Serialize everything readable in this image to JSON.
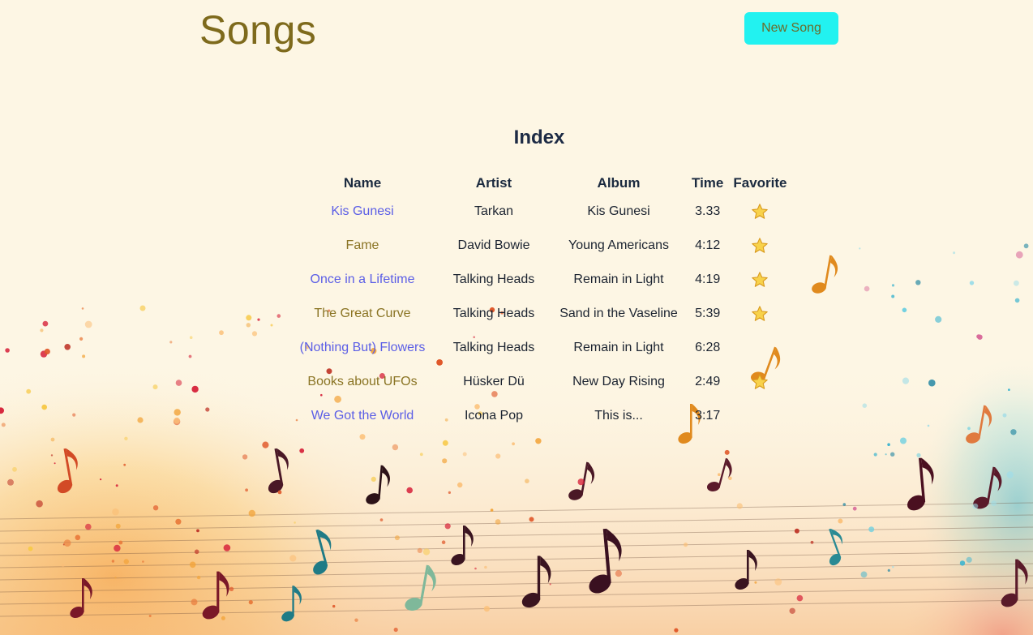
{
  "header": {
    "title": "Songs",
    "new_song_label": "New Song"
  },
  "index": {
    "heading": "Index",
    "columns": [
      "Name",
      "Artist",
      "Album",
      "Time",
      "Favorite"
    ],
    "rows": [
      {
        "name": "Kis Gunesi",
        "artist": "Tarkan",
        "album": "Kis Gunesi",
        "time": "3.33",
        "favorite": true,
        "link_color": "blue"
      },
      {
        "name": "Fame",
        "artist": "David Bowie",
        "album": "Young Americans",
        "time": "4:12",
        "favorite": true,
        "link_color": "gold"
      },
      {
        "name": "Once in a Lifetime",
        "artist": "Talking Heads",
        "album": "Remain in Light",
        "time": "4:19",
        "favorite": true,
        "link_color": "blue"
      },
      {
        "name": "The Great Curve",
        "artist": "Talking Heads",
        "album": "Sand in the Vaseline",
        "time": "5:39",
        "favorite": true,
        "link_color": "gold"
      },
      {
        "name": "(Nothing But) Flowers",
        "artist": "Talking Heads",
        "album": "Remain in Light",
        "time": "6:28",
        "favorite": false,
        "link_color": "blue"
      },
      {
        "name": "Books about UFOs",
        "artist": "Hüsker Dü",
        "album": "New Day Rising",
        "time": "2:49",
        "favorite": true,
        "link_color": "gold"
      },
      {
        "name": "We Got the World",
        "artist": "Icona Pop",
        "album": "This is...",
        "time": "3:17",
        "favorite": false,
        "link_color": "blue"
      }
    ]
  },
  "theme": {
    "title_color": "#7e6a1c",
    "button_color": "#22f2f0",
    "link_blue": "#5b5ee6",
    "link_gold": "#8a7424",
    "background": "#fdf6e4"
  },
  "icons": {
    "favorite": "star-icon",
    "background": "music-notes-confetti-background"
  }
}
